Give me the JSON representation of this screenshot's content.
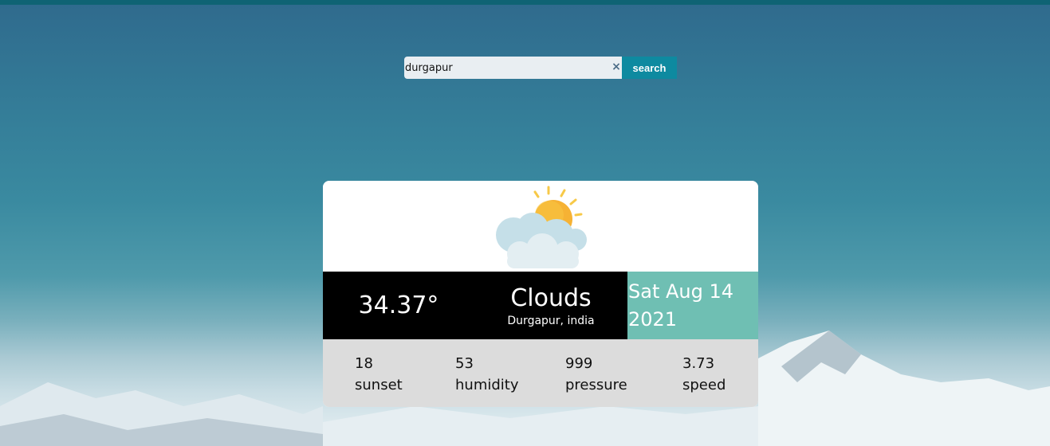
{
  "search": {
    "value": "durgapur",
    "clear_icon": "×",
    "button_label": "search"
  },
  "weather": {
    "icon": "partly-cloudy-sun-icon",
    "temperature": "34.37°",
    "condition": "Clouds",
    "location": "Durgapur, india",
    "date_line1": "Sat Aug 14",
    "date_line2": "2021"
  },
  "stats": [
    {
      "value": "18",
      "label": "sunset"
    },
    {
      "value": "53",
      "label": "humidity"
    },
    {
      "value": "999",
      "label": "pressure"
    },
    {
      "value": "3.73",
      "label": "speed"
    }
  ],
  "colors": {
    "topbar": "#0f6374",
    "search_button": "#0e8aa0",
    "date_panel": "#6fbfb3",
    "stats_panel": "#dcdcdc",
    "dark_panel": "#000000"
  }
}
